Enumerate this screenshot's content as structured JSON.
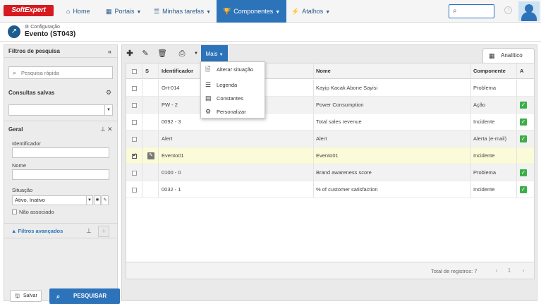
{
  "topbar": {
    "logo": "SoftExpert",
    "nav": [
      {
        "label": "Home",
        "icon": "⌂"
      },
      {
        "label": "Portais",
        "icon": "▦"
      },
      {
        "label": "Minhas tarefas",
        "icon": "☰"
      },
      {
        "label": "Componentes",
        "icon": "🏆"
      },
      {
        "label": "Atalhos",
        "icon": "⚡"
      }
    ],
    "search_icon": "⌕",
    "info_icon": "!"
  },
  "page": {
    "breadcrumb": "Configuração",
    "title": "Evento (ST043)"
  },
  "filters": {
    "title": "Filtros de pesquisa",
    "quick_search_placeholder": "Pesquisa rápida",
    "saved_queries": "Consultas salvas",
    "general": "Geral",
    "identifier_label": "Identificador",
    "name_label": "Nome",
    "status_label": "Situação",
    "status_value": "Ativo, Inativo",
    "not_associated": "Não associado",
    "advanced": "Filtros avançados",
    "save": "Salvar",
    "search": "PESQUISAR"
  },
  "toolbar": {
    "more": "Mais",
    "analytic_tab": "Analítico"
  },
  "menu": [
    {
      "label": "Alterar situação",
      "icon": "📄"
    },
    {
      "label": "Legenda",
      "icon": "☰"
    },
    {
      "label": "Constantes",
      "icon": "▤"
    },
    {
      "label": "Personalizar",
      "icon": "⚙"
    }
  ],
  "table": {
    "headers": {
      "s": "S",
      "identifier": "Identificador",
      "name": "Nome",
      "component": "Componente",
      "a": "A"
    },
    "rows": [
      {
        "id": "Ort-014",
        "name": "Kayip Kacak Abone Sayisi",
        "component": "Problema",
        "active": false,
        "selected": false
      },
      {
        "id": "PW - 2",
        "name": "Power Consumption",
        "component": "Ação",
        "active": true,
        "selected": false
      },
      {
        "id": "0092 - 3",
        "name": "Total sales revenue",
        "component": "Incidente",
        "active": true,
        "selected": false
      },
      {
        "id": "Alert",
        "name": "Alert",
        "component": "Alerta (e-mail)",
        "active": true,
        "selected": false
      },
      {
        "id": "Evento01",
        "name": "Evento01",
        "component": "Incidente",
        "active": false,
        "selected": true
      },
      {
        "id": "0100 - 0",
        "name": "Brand awareness score",
        "component": "Problema",
        "active": true,
        "selected": false
      },
      {
        "id": "0032 - 1",
        "name": "% of customer satisfaction",
        "component": "Incidente",
        "active": true,
        "selected": false
      }
    ],
    "total": "Total de registros: 7",
    "page": "1"
  },
  "colors": {
    "accent": "#2d73b9",
    "selected_row": "#fcfbd9",
    "alt_row": "#f2f2f2",
    "check": "#3cae49"
  }
}
